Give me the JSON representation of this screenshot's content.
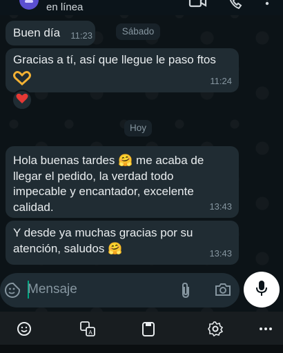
{
  "header": {
    "status": "en línea",
    "icons": [
      "avatar",
      "video-call-icon",
      "phone-icon",
      "more-options-icon"
    ]
  },
  "messages": [
    {
      "text": "Buen día",
      "time": "11:23"
    },
    {
      "text": "Gracias a tí, así que llegue le paso ftos",
      "time": "11:24",
      "emoji": "heart-hands"
    },
    {
      "text": "Hola buenas tardes 🤗  me acaba de llegar el pedido, la verdad todo impecable y encantador, excelente calidad.",
      "time": "13:43"
    },
    {
      "text": "Y desde ya muchas gracias por su atención, saludos 🤗",
      "time": "13:43"
    }
  ],
  "date_pills": {
    "saturday": "Sábado",
    "today": "Hoy"
  },
  "reaction": {
    "icon": "red-heart-icon",
    "color": "#e53935"
  },
  "composer": {
    "placeholder": "Mensaje",
    "icons": [
      "sticker-icon",
      "attach-icon",
      "camera-icon",
      "mic-icon"
    ]
  },
  "toolbar": {
    "icons": [
      "emoji-icon",
      "translate-icon",
      "clipboard-icon",
      "settings-icon",
      "more-icon"
    ]
  },
  "colors": {
    "bubble": "#202c33",
    "accent": "#00a884",
    "background": "#0c1317"
  }
}
